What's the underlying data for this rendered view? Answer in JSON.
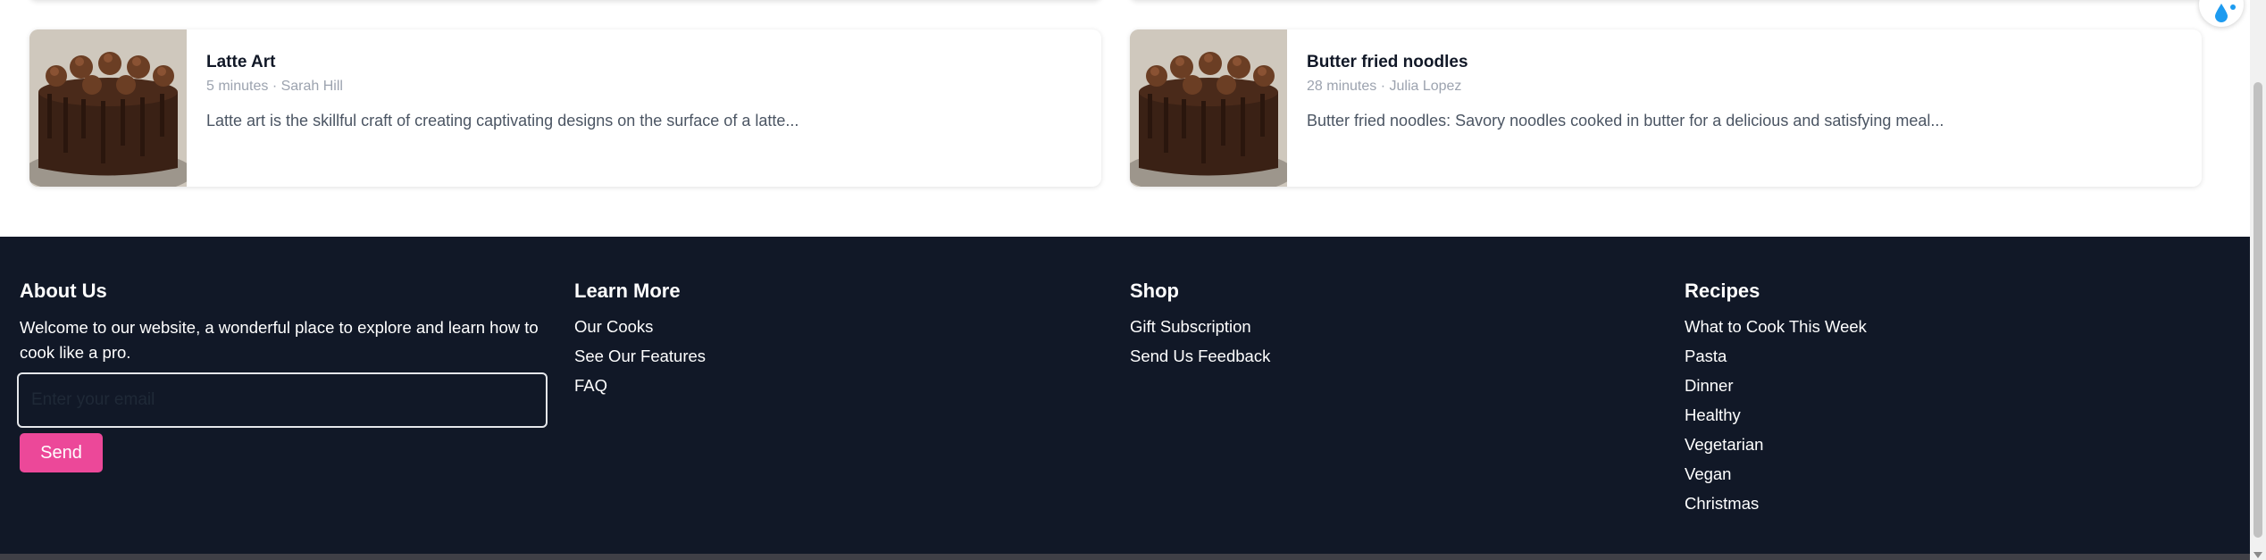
{
  "cards": [
    {
      "title": "Latte Art",
      "meta": "5 minutes · Sarah Hill",
      "description": "Latte art is the skillful craft of creating captivating designs on the surface of a latte..."
    },
    {
      "title": "Butter fried noodles",
      "meta": "28 minutes · Julia Lopez",
      "description": "Butter fried noodles: Savory noodles cooked in butter for a delicious and satisfying meal..."
    }
  ],
  "footer": {
    "about": {
      "heading": "About Us",
      "text": "Welcome to our website, a wonderful place to explore and learn how to cook like a pro.",
      "email_placeholder": "Enter your email",
      "send_label": "Send"
    },
    "learn_more": {
      "heading": "Learn More",
      "links": [
        "Our Cooks",
        "See Our Features",
        "FAQ"
      ]
    },
    "shop": {
      "heading": "Shop",
      "links": [
        "Gift Subscription",
        "Send Us Feedback"
      ]
    },
    "recipes": {
      "heading": "Recipes",
      "links": [
        "What to Cook This Week",
        "Pasta",
        "Dinner",
        "Healthy",
        "Vegetarian",
        "Vegan",
        "Christmas"
      ]
    }
  },
  "colors": {
    "footer_bg": "#111827",
    "accent": "#ec4899"
  },
  "icons": {
    "widget": "water-drop-icon"
  }
}
